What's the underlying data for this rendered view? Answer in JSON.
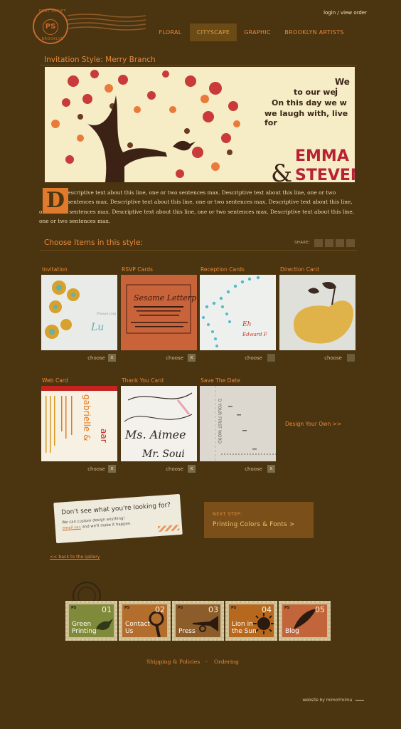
{
  "logo": {
    "top_text": "POST SCRIPT",
    "center_text": "PS",
    "bottom_text": "BROOKLYN"
  },
  "header": {
    "login_link": "login",
    "separator": "/",
    "view_order_link": "view order"
  },
  "nav": {
    "items": [
      "FLORAL",
      "CITYSCAPE",
      "GRAPHIC",
      "BROOKLYN ARTISTS"
    ],
    "active": "CITYSCAPE"
  },
  "invitation": {
    "title": "Invitation Style: Merry Branch",
    "hero_lines": [
      "We j",
      "to our we",
      "On this day we w",
      "we laugh with, live for"
    ],
    "hero_name_1": "EMMA",
    "hero_amp": "&",
    "hero_name_2": "STEVEN",
    "dropcap": "D",
    "description": "escriptive text about this line, one or two sentences max. Descriptive text about this line, one or two sentences max. Descriptive text about this line, one or two sentences max. Descriptive text about this line, one or two sentences max. Descriptive text about this line, one or two sentences max. Descriptive text about this line, one or two sentences max."
  },
  "choose_section": {
    "title": "Choose Items in this style:",
    "share_label": "SHARE:",
    "choose_label": "choose",
    "x_label": "x",
    "items_row1": [
      {
        "label": "Invitation",
        "selected": true
      },
      {
        "label": "RSVP Cards",
        "selected": true
      },
      {
        "label": "Reception Cards",
        "selected": false
      },
      {
        "label": "Direction Card",
        "selected": false
      }
    ],
    "items_row2": [
      {
        "label": "Web Card",
        "selected": true
      },
      {
        "label": "Thank You Card",
        "selected": true
      },
      {
        "label": "Save The Date",
        "selected": true
      }
    ],
    "design_own": "Design Your Own >>"
  },
  "note_card": {
    "title": "Don't see what you're looking for?",
    "line1": "We can custom design anything!",
    "email_link": "email us»",
    "line2_rest": " and we'll make it happen."
  },
  "next_step": {
    "label": "NEXT STEP:",
    "link": "Printing Colors & Fonts >"
  },
  "back_link": "<< back to the gallery",
  "stamps": [
    {
      "num": "01",
      "label": "Green\nPrinting",
      "ps": "PS",
      "color": "#7f8a3a"
    },
    {
      "num": "02",
      "label": "Contact\nUs",
      "ps": "PS",
      "color": "#b36d2d"
    },
    {
      "num": "03",
      "label": "Press",
      "ps": "PS",
      "color": "#8c5d2a"
    },
    {
      "num": "04",
      "label": "Lion in\nthe Sun",
      "ps": "PS",
      "color": "#b7681f"
    },
    {
      "num": "05",
      "label": "Blog",
      "ps": "PS",
      "color": "#c2653a"
    }
  ],
  "footer": {
    "shipping": "Shipping & Policies",
    "dot": "·",
    "ordering": "Ordering",
    "credit": "website by mimoYmima"
  }
}
